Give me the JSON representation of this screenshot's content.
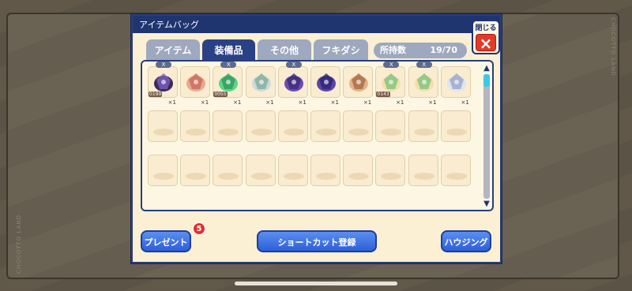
{
  "panel": {
    "title": "アイテムバッグ",
    "close_label": "閉じる",
    "close_icon": "×"
  },
  "tabs": [
    {
      "label": "アイテム",
      "active": false
    },
    {
      "label": "装備品",
      "active": true
    },
    {
      "label": "その他",
      "active": false
    },
    {
      "label": "フキダシ",
      "active": false
    }
  ],
  "count": {
    "label": "所持数",
    "value": "19/70"
  },
  "items": [
    {
      "name": "dark-wings-icon",
      "qty": "×1",
      "x_badge": "X",
      "code": "0199"
    },
    {
      "name": "pink-bag-icon",
      "qty": "×1",
      "x_badge": "",
      "code": ""
    },
    {
      "name": "green-vine-icon",
      "qty": "×1",
      "x_badge": "X",
      "code": "0055"
    },
    {
      "name": "crystal-drop-icon",
      "qty": "×1",
      "x_badge": "",
      "code": ""
    },
    {
      "name": "purple-armor-icon",
      "qty": "×1",
      "x_badge": "X",
      "code": ""
    },
    {
      "name": "purple-armor-2-icon",
      "qty": "×1",
      "x_badge": "",
      "code": ""
    },
    {
      "name": "gift-box-icon",
      "qty": "×1",
      "x_badge": "",
      "code": ""
    },
    {
      "name": "flower-bear-icon",
      "qty": "×1",
      "x_badge": "X",
      "code": "0143"
    },
    {
      "name": "flower-bear-2-icon",
      "qty": "×1",
      "x_badge": "X",
      "code": ""
    },
    {
      "name": "shell-icon",
      "qty": "×1",
      "x_badge": "",
      "code": ""
    }
  ],
  "buttons": {
    "present": "プレゼント",
    "present_badge": "5",
    "shortcut": "ショートカット登録",
    "housing": "ハウジング"
  },
  "frame": {
    "brand_text": "CHOCOTTO LAND"
  },
  "colors": {
    "accent": "#1f3570",
    "button": "#2d5fd8",
    "badge": "#e32d2d",
    "panel_bg": "#fbf0d4"
  }
}
